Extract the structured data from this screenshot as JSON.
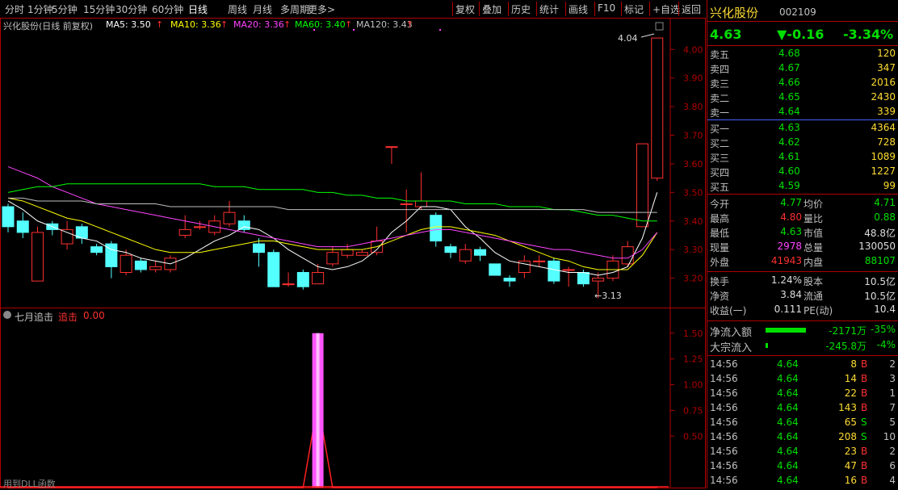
{
  "toolbar": {
    "periods": [
      "分时",
      "1分钟",
      "5分钟",
      "15分钟",
      "30分钟",
      "60分钟",
      "日线",
      "周线",
      "月线",
      "多周期",
      "更多>"
    ],
    "active_period": "日线",
    "tools": [
      "复权",
      "叠加",
      "历史",
      "统计",
      "画线",
      "F10",
      "标记",
      "+自选",
      "返回"
    ]
  },
  "main_chart": {
    "stock_label": "兴化股份(日线 前复权)",
    "ma_labels": [
      {
        "text": "MA5: 3.50",
        "arrow": "↑",
        "color": "#ffffff"
      },
      {
        "text": "MA10: 3.36",
        "arrow": "↑",
        "color": "#ffff00"
      },
      {
        "text": "MA20: 3.36",
        "arrow": "↑",
        "color": "#ff44ff"
      },
      {
        "text": "MA60: 3.40",
        "arrow": "↑",
        "color": "#00ff00"
      },
      {
        "text": "MA120: 3.43",
        "arrow": "↑",
        "color": "#c0c0c0"
      }
    ],
    "y_ticks": [
      "4.00",
      "3.90",
      "3.80",
      "3.70",
      "3.60",
      "3.50",
      "3.40",
      "3.30",
      "3.20"
    ],
    "high_label": "4.04",
    "low_label": "←3.13"
  },
  "indicator": {
    "name": "七月追击",
    "series_label": "追击",
    "value": "0.00",
    "y_ticks": [
      "1.50",
      "1.25",
      "1.00",
      "0.75",
      "0.50"
    ],
    "footer": "用到DLL函数"
  },
  "chart_data": {
    "type": "candlestick",
    "ylim": [
      3.1,
      4.06
    ],
    "candles": [
      {
        "o": 3.45,
        "c": 3.38,
        "h": 3.46,
        "l": 3.36
      },
      {
        "o": 3.4,
        "c": 3.36,
        "h": 3.43,
        "l": 3.34
      },
      {
        "o": 3.19,
        "c": 3.36,
        "h": 3.38,
        "l": 3.19
      },
      {
        "o": 3.39,
        "c": 3.37,
        "h": 3.4,
        "l": 3.35
      },
      {
        "o": 3.32,
        "c": 3.37,
        "h": 3.4,
        "l": 3.3
      },
      {
        "o": 3.38,
        "c": 3.34,
        "h": 3.39,
        "l": 3.32
      },
      {
        "o": 3.31,
        "c": 3.29,
        "h": 3.32,
        "l": 3.28
      },
      {
        "o": 3.32,
        "c": 3.24,
        "h": 3.33,
        "l": 3.2
      },
      {
        "o": 3.22,
        "c": 3.28,
        "h": 3.3,
        "l": 3.21
      },
      {
        "o": 3.26,
        "c": 3.23,
        "h": 3.27,
        "l": 3.22
      },
      {
        "o": 3.23,
        "c": 3.24,
        "h": 3.26,
        "l": 3.22
      },
      {
        "o": 3.23,
        "c": 3.27,
        "h": 3.28,
        "l": 3.22
      },
      {
        "o": 3.35,
        "c": 3.37,
        "h": 3.42,
        "l": 3.34
      },
      {
        "o": 3.38,
        "c": 3.38,
        "h": 3.4,
        "l": 3.37
      },
      {
        "o": 3.36,
        "c": 3.4,
        "h": 3.42,
        "l": 3.35
      },
      {
        "o": 3.39,
        "c": 3.43,
        "h": 3.47,
        "l": 3.38
      },
      {
        "o": 3.4,
        "c": 3.37,
        "h": 3.42,
        "l": 3.36
      },
      {
        "o": 3.32,
        "c": 3.29,
        "h": 3.34,
        "l": 3.24
      },
      {
        "o": 3.29,
        "c": 3.17,
        "h": 3.3,
        "l": 3.17
      },
      {
        "o": 3.18,
        "c": 3.18,
        "h": 3.22,
        "l": 3.17
      },
      {
        "o": 3.22,
        "c": 3.17,
        "h": 3.23,
        "l": 3.16
      },
      {
        "o": 3.18,
        "c": 3.22,
        "h": 3.25,
        "l": 3.18
      },
      {
        "o": 3.25,
        "c": 3.29,
        "h": 3.31,
        "l": 3.24
      },
      {
        "o": 3.28,
        "c": 3.3,
        "h": 3.32,
        "l": 3.27
      },
      {
        "o": 3.28,
        "c": 3.29,
        "h": 3.3,
        "l": 3.28
      },
      {
        "o": 3.29,
        "c": 3.33,
        "h": 3.38,
        "l": 3.28
      },
      {
        "o": 3.66,
        "c": 3.66,
        "h": 3.66,
        "l": 3.6
      },
      {
        "o": 3.46,
        "c": 3.46,
        "h": 3.51,
        "l": 3.36
      },
      {
        "o": 3.45,
        "c": 3.47,
        "h": 3.57,
        "l": 3.44
      },
      {
        "o": 3.42,
        "c": 3.33,
        "h": 3.43,
        "l": 3.31
      },
      {
        "o": 3.31,
        "c": 3.29,
        "h": 3.32,
        "l": 3.27
      },
      {
        "o": 3.26,
        "c": 3.3,
        "h": 3.32,
        "l": 3.25
      },
      {
        "o": 3.3,
        "c": 3.28,
        "h": 3.31,
        "l": 3.26
      },
      {
        "o": 3.25,
        "c": 3.21,
        "h": 3.25,
        "l": 3.21
      },
      {
        "o": 3.2,
        "c": 3.19,
        "h": 3.21,
        "l": 3.17
      },
      {
        "o": 3.22,
        "c": 3.26,
        "h": 3.28,
        "l": 3.2
      },
      {
        "o": 3.26,
        "c": 3.26,
        "h": 3.28,
        "l": 3.24
      },
      {
        "o": 3.26,
        "c": 3.19,
        "h": 3.27,
        "l": 3.18
      },
      {
        "o": 3.23,
        "c": 3.23,
        "h": 3.24,
        "l": 3.17
      },
      {
        "o": 3.22,
        "c": 3.18,
        "h": 3.23,
        "l": 3.17
      },
      {
        "o": 3.19,
        "c": 3.2,
        "h": 3.22,
        "l": 3.13
      },
      {
        "o": 3.2,
        "c": 3.26,
        "h": 3.28,
        "l": 3.19
      },
      {
        "o": 3.25,
        "c": 3.31,
        "h": 3.33,
        "l": 3.24
      },
      {
        "o": 3.38,
        "c": 3.67,
        "h": 3.67,
        "l": 3.38
      },
      {
        "o": 3.55,
        "c": 4.04,
        "h": 4.04,
        "l": 3.54
      }
    ],
    "ma_series": [
      {
        "name": "MA5",
        "color": "#ffffff",
        "values": [
          3.47,
          3.44,
          3.4,
          3.38,
          3.36,
          3.34,
          3.33,
          3.3,
          3.29,
          3.27,
          3.26,
          3.25,
          3.27,
          3.3,
          3.33,
          3.35,
          3.38,
          3.37,
          3.34,
          3.3,
          3.27,
          3.24,
          3.23,
          3.24,
          3.26,
          3.3,
          3.36,
          3.4,
          3.45,
          3.45,
          3.44,
          3.38,
          3.34,
          3.29,
          3.26,
          3.25,
          3.24,
          3.23,
          3.22,
          3.22,
          3.21,
          3.22,
          3.24,
          3.34,
          3.5
        ]
      },
      {
        "name": "MA10",
        "color": "#ffff00",
        "values": [
          3.48,
          3.47,
          3.45,
          3.43,
          3.41,
          3.4,
          3.38,
          3.36,
          3.34,
          3.32,
          3.3,
          3.29,
          3.29,
          3.29,
          3.3,
          3.31,
          3.32,
          3.33,
          3.33,
          3.32,
          3.31,
          3.3,
          3.3,
          3.3,
          3.3,
          3.31,
          3.33,
          3.35,
          3.37,
          3.38,
          3.38,
          3.37,
          3.36,
          3.35,
          3.33,
          3.31,
          3.29,
          3.27,
          3.26,
          3.24,
          3.23,
          3.23,
          3.23,
          3.28,
          3.36
        ]
      },
      {
        "name": "MA20",
        "color": "#ff44ff",
        "values": [
          3.59,
          3.57,
          3.55,
          3.52,
          3.5,
          3.48,
          3.46,
          3.45,
          3.44,
          3.43,
          3.42,
          3.41,
          3.4,
          3.39,
          3.38,
          3.37,
          3.36,
          3.35,
          3.34,
          3.33,
          3.32,
          3.31,
          3.31,
          3.31,
          3.32,
          3.33,
          3.34,
          3.35,
          3.36,
          3.37,
          3.37,
          3.36,
          3.35,
          3.34,
          3.33,
          3.32,
          3.31,
          3.3,
          3.3,
          3.29,
          3.28,
          3.27,
          3.27,
          3.3,
          3.36
        ]
      },
      {
        "name": "MA60",
        "color": "#00ff00",
        "values": [
          3.5,
          3.51,
          3.52,
          3.52,
          3.53,
          3.53,
          3.53,
          3.53,
          3.53,
          3.53,
          3.53,
          3.53,
          3.53,
          3.53,
          3.52,
          3.52,
          3.52,
          3.51,
          3.51,
          3.51,
          3.51,
          3.5,
          3.5,
          3.49,
          3.49,
          3.48,
          3.48,
          3.47,
          3.47,
          3.47,
          3.47,
          3.46,
          3.46,
          3.46,
          3.45,
          3.45,
          3.45,
          3.44,
          3.44,
          3.43,
          3.42,
          3.42,
          3.41,
          3.4,
          3.4
        ]
      },
      {
        "name": "MA120",
        "color": "#c0c0c0",
        "values": [
          3.48,
          3.48,
          3.47,
          3.47,
          3.47,
          3.47,
          3.46,
          3.46,
          3.46,
          3.46,
          3.46,
          3.45,
          3.45,
          3.45,
          3.45,
          3.45,
          3.45,
          3.45,
          3.45,
          3.44,
          3.44,
          3.44,
          3.44,
          3.44,
          3.44,
          3.44,
          3.44,
          3.44,
          3.44,
          3.44,
          3.44,
          3.44,
          3.44,
          3.44,
          3.44,
          3.44,
          3.44,
          3.44,
          3.44,
          3.44,
          3.43,
          3.43,
          3.43,
          3.43,
          3.43
        ]
      }
    ],
    "indicator_values": [
      0,
      0,
      0,
      0,
      0,
      0,
      0,
      0,
      0,
      0,
      0,
      0,
      0,
      0,
      0,
      0,
      0,
      0,
      0,
      0,
      0,
      1.5,
      0,
      0,
      0,
      0,
      0,
      0,
      0,
      0,
      0,
      0,
      0,
      0,
      0,
      0,
      0,
      0,
      0,
      0,
      0,
      0,
      0,
      0,
      0
    ],
    "indicator_ylim": [
      0,
      1.6
    ]
  },
  "quote": {
    "name": "兴化股份",
    "code": "002109",
    "price": "4.63",
    "change": "▼-0.16",
    "pct": "-3.34%",
    "asks": [
      {
        "label": "卖五",
        "price": "4.68",
        "vol": "120"
      },
      {
        "label": "卖四",
        "price": "4.67",
        "vol": "347"
      },
      {
        "label": "卖三",
        "price": "4.66",
        "vol": "2016"
      },
      {
        "label": "卖二",
        "price": "4.65",
        "vol": "2430"
      },
      {
        "label": "卖一",
        "price": "4.64",
        "vol": "339"
      }
    ],
    "bids": [
      {
        "label": "买一",
        "price": "4.63",
        "vol": "4364"
      },
      {
        "label": "买二",
        "price": "4.62",
        "vol": "728"
      },
      {
        "label": "买三",
        "price": "4.61",
        "vol": "1089"
      },
      {
        "label": "买四",
        "price": "4.60",
        "vol": "1227"
      },
      {
        "label": "买五",
        "price": "4.59",
        "vol": "99"
      }
    ],
    "stats": [
      {
        "l1": "今开",
        "v1": "4.77",
        "c1": "g",
        "l2": "均价",
        "v2": "4.71",
        "c2": "g"
      },
      {
        "l1": "最高",
        "v1": "4.80",
        "c1": "r",
        "l2": "量比",
        "v2": "0.88",
        "c2": "g"
      },
      {
        "l1": "最低",
        "v1": "4.63",
        "c1": "g",
        "l2": "市值",
        "v2": "48.8亿",
        "c2": "w"
      },
      {
        "l1": "现量",
        "v1": "2978",
        "c1": "m",
        "l2": "总量",
        "v2": "130050",
        "c2": "w"
      },
      {
        "l1": "外盘",
        "v1": "41943",
        "c1": "r",
        "l2": "内盘",
        "v2": "88107",
        "c2": "g"
      }
    ],
    "fin": [
      {
        "l1": "换手",
        "v1": "1.24%",
        "l2": "股本",
        "v2": "10.5亿"
      },
      {
        "l1": "净资",
        "v1": "3.84",
        "l2": "流通",
        "v2": "10.5亿"
      },
      {
        "l1": "收益(一)",
        "v1": "0.111",
        "l2": "PE(动)",
        "v2": "10.4"
      }
    ],
    "flow": [
      {
        "label": "净流入额",
        "val": "-2171万",
        "pct": "-35%",
        "bar": 0.9
      },
      {
        "label": "大宗流入",
        "val": "-245.8万",
        "pct": "-4%",
        "bar": 0.06
      }
    ],
    "ticks": [
      {
        "t": "14:56",
        "p": "4.64",
        "v": "8",
        "d": "B",
        "n": "2"
      },
      {
        "t": "14:56",
        "p": "4.64",
        "v": "14",
        "d": "B",
        "n": "3"
      },
      {
        "t": "14:56",
        "p": "4.64",
        "v": "22",
        "d": "B",
        "n": "1"
      },
      {
        "t": "14:56",
        "p": "4.64",
        "v": "143",
        "d": "B",
        "n": "7"
      },
      {
        "t": "14:56",
        "p": "4.64",
        "v": "65",
        "d": "S",
        "n": "5"
      },
      {
        "t": "14:56",
        "p": "4.64",
        "v": "208",
        "d": "S",
        "n": "10"
      },
      {
        "t": "14:56",
        "p": "4.64",
        "v": "23",
        "d": "B",
        "n": "2"
      },
      {
        "t": "14:56",
        "p": "4.64",
        "v": "47",
        "d": "B",
        "n": "6"
      },
      {
        "t": "14:56",
        "p": "4.64",
        "v": "16",
        "d": "B",
        "n": "4"
      }
    ]
  }
}
